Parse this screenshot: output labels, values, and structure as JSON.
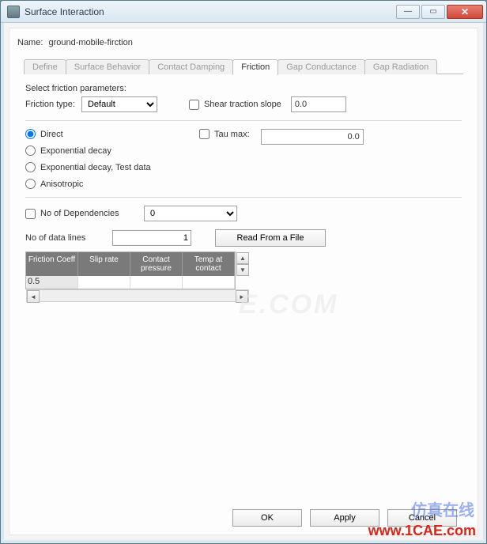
{
  "window": {
    "title": "Surface Interaction"
  },
  "name": {
    "label": "Name:",
    "value": "ground-mobile-firction"
  },
  "tabs": {
    "define": "Define",
    "behavior": "Surface Behavior",
    "damping": "Contact Damping",
    "friction": "Friction",
    "conductance": "Gap Conductance",
    "radiation": "Gap Radiation"
  },
  "friction": {
    "select_label": "Select friction parameters:",
    "type_label": "Friction type:",
    "type_value": "Default",
    "shear_slope_label": "Shear traction slope",
    "shear_slope_value": "0.0",
    "radios": {
      "direct": "Direct",
      "exp_decay": "Exponential decay",
      "exp_decay_test": "Exponential decay, Test data",
      "anisotropic": "Anisotropic"
    },
    "taumax_label": "Tau max:",
    "taumax_value": "0.0",
    "deps_label": "No of Dependencies",
    "deps_value": "0",
    "lines_label": "No of data lines",
    "lines_value": "1",
    "read_button": "Read From a File",
    "columns": {
      "c1": "Friction Coeff",
      "c2": "Slip rate",
      "c3": "Contact pressure",
      "c4": "Temp at contact"
    },
    "rows": [
      {
        "c1": "0.5",
        "c2": "",
        "c3": "",
        "c4": ""
      }
    ]
  },
  "buttons": {
    "ok": "OK",
    "apply": "Apply",
    "cancel": "Cancel"
  },
  "watermarks": {
    "ghost": "E.COM",
    "cn": "仿真在线",
    "url": "www.1CAE.com"
  }
}
